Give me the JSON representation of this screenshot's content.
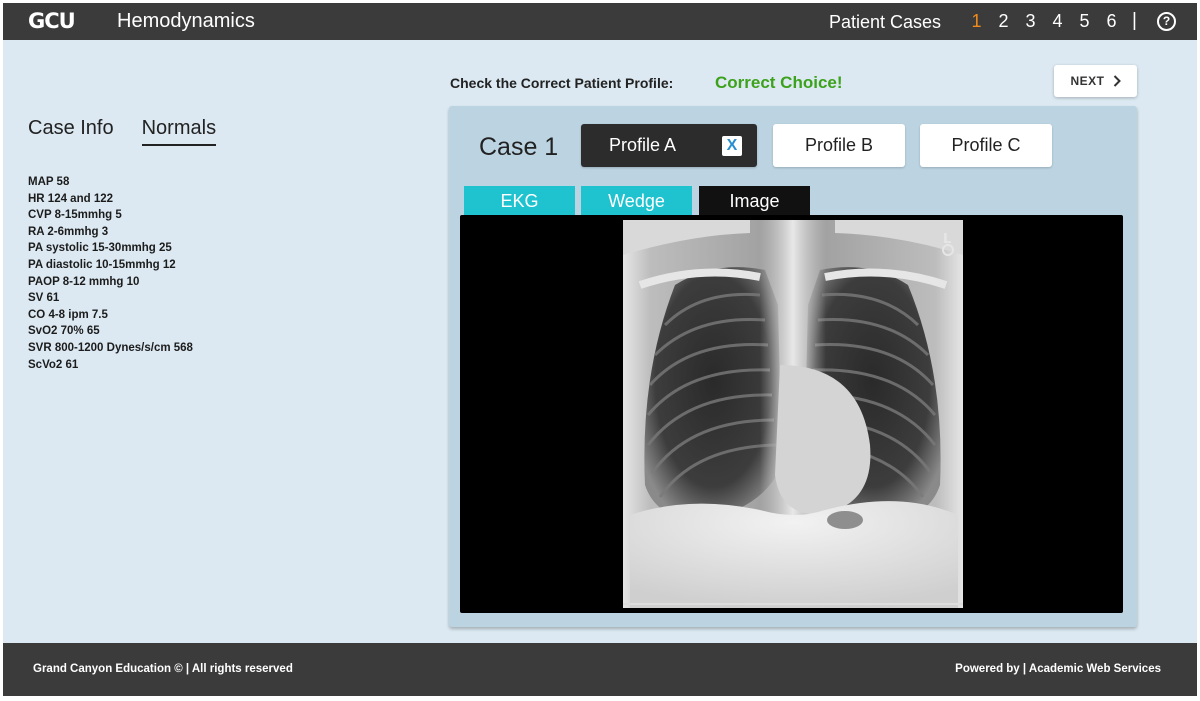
{
  "header": {
    "logo": "GCU",
    "app_title": "Hemodynamics",
    "cases_label": "Patient Cases",
    "case_numbers": [
      "1",
      "2",
      "3",
      "4",
      "5",
      "6"
    ],
    "active_case": "1",
    "separator": "|",
    "help_icon": "?"
  },
  "left_panel": {
    "tabs": [
      {
        "label": "Case Info",
        "active": false
      },
      {
        "label": "Normals",
        "active": true
      }
    ],
    "normals": [
      "MAP 58",
      "HR 124 and 122",
      "CVP 8-15mmhg 5",
      "RA 2-6mmhg 3",
      "PA systolic 15-30mmhg 25",
      "PA diastolic 10-15mmhg 12",
      "PAOP 8-12 mmhg 10",
      "SV 61",
      "CO 4-8 ipm 7.5",
      "SvO2 70% 65",
      "SVR 800-1200 Dynes/s/cm 568",
      "ScVo2 61"
    ]
  },
  "prompt": {
    "label": "Check the Correct Patient Profile:",
    "result": "Correct Choice!",
    "result_color": "#3ca21c"
  },
  "next_button": {
    "label": "NEXT",
    "icon": "chevron-right-icon"
  },
  "case": {
    "title": "Case 1",
    "profiles": [
      {
        "label": "Profile A",
        "selected": true,
        "mark": "X"
      },
      {
        "label": "Profile B",
        "selected": false
      },
      {
        "label": "Profile C",
        "selected": false
      }
    ],
    "media_tabs": [
      {
        "label": "EKG",
        "active": false
      },
      {
        "label": "Wedge",
        "active": false
      },
      {
        "label": "Image",
        "active": true
      }
    ],
    "image_marker": "L"
  },
  "footer": {
    "left": "Grand Canyon Education © | All rights reserved",
    "right": "Powered by | Academic Web Services"
  },
  "colors": {
    "accent_orange": "#f08a1c",
    "tab_teal": "#1fc3cf",
    "header_bg": "#3b3b3b",
    "page_bg": "#dce9f2"
  }
}
